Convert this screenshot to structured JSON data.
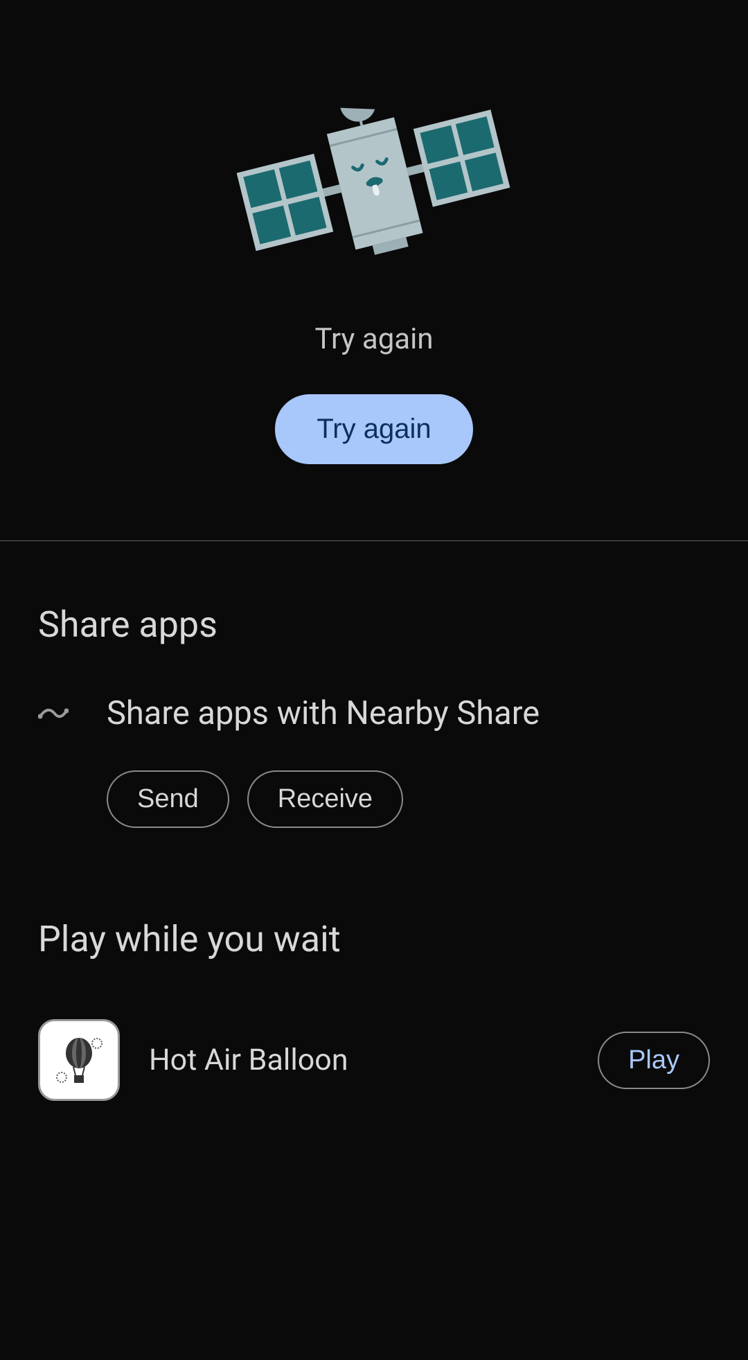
{
  "error": {
    "message": "Try again",
    "button_label": "Try again"
  },
  "share": {
    "section_title": "Share apps",
    "nearby_text": "Share apps with Nearby Share",
    "send_label": "Send",
    "receive_label": "Receive"
  },
  "play": {
    "section_title": "Play while you wait",
    "game_title": "Hot Air Balloon",
    "play_label": "Play"
  }
}
